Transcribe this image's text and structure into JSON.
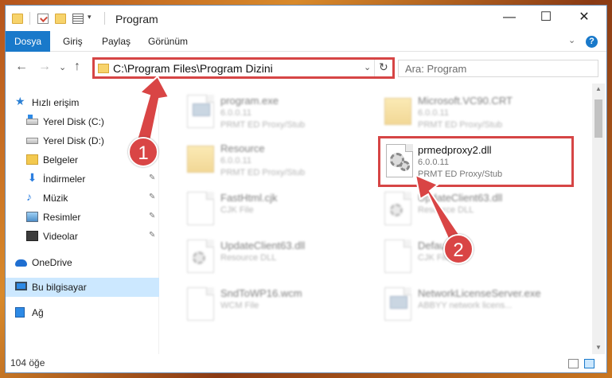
{
  "window": {
    "title": "Program",
    "controls": {
      "minimize": "—",
      "maximize": "☐",
      "close": "✕"
    }
  },
  "ribbon": {
    "tabs": [
      {
        "label": "Dosya"
      },
      {
        "label": "Giriş"
      },
      {
        "label": "Paylaş"
      },
      {
        "label": "Görünüm"
      }
    ],
    "collapse": "⌄",
    "help": "?"
  },
  "navigation": {
    "back": "←",
    "forward": "→",
    "history": "⌄",
    "up": "↑",
    "address": "C:\\Program Files\\Program Dizini",
    "address_dropdown": "⌄",
    "refresh": "↻",
    "search_placeholder": "Ara: Program"
  },
  "sidebar": {
    "items": [
      {
        "label": "Hızlı erişim",
        "icon": "star-icon"
      },
      {
        "label": "Yerel Disk (C:)",
        "icon": "drive-icon"
      },
      {
        "label": "Yerel Disk (D:)",
        "icon": "drive-icon"
      },
      {
        "label": "Belgeler",
        "icon": "folder-icon"
      },
      {
        "label": "İndirmeler",
        "icon": "download-icon"
      },
      {
        "label": "Müzik",
        "icon": "music-icon"
      },
      {
        "label": "Resimler",
        "icon": "pictures-icon"
      },
      {
        "label": "Videolar",
        "icon": "video-icon"
      },
      {
        "label": "OneDrive",
        "icon": "cloud-icon"
      },
      {
        "label": "Bu bilgisayar",
        "icon": "computer-icon"
      },
      {
        "label": "Ağ",
        "icon": "network-icon"
      }
    ],
    "pin": "📌"
  },
  "files": [
    {
      "name": "program.exe",
      "version": "6.0.0.11",
      "desc": "PRMT ED Proxy/Stub",
      "icon": "exe-icon"
    },
    {
      "name": "Microsoft.VC90.CRT",
      "version": "6.0.0.11",
      "desc": "PRMT ED Proxy/Stub",
      "icon": "folder-icon"
    },
    {
      "name": "Resource",
      "version": "6.0.0.11",
      "desc": "PRMT ED Proxy/Stub",
      "icon": "folder-icon"
    },
    {
      "name": "prmedproxy2.dll",
      "version": "6.0.0.11",
      "desc": "PRMT ED Proxy/Stub",
      "icon": "dll-icon"
    },
    {
      "name": "FastHtml.cjk",
      "version": "CJK File",
      "desc": "",
      "icon": "file-icon"
    },
    {
      "name": "UpdateClient63.dll",
      "version": "Resource DLL",
      "desc": "",
      "icon": "dll-icon"
    },
    {
      "name": "UpdateClient63.dll",
      "version": "Resource DLL",
      "desc": "",
      "icon": "dll-icon"
    },
    {
      "name": "Default.cjk",
      "version": "CJK File",
      "desc": "",
      "icon": "file-icon"
    },
    {
      "name": "SndToWP16.wcm",
      "version": "WCM File",
      "desc": "",
      "icon": "file-icon"
    },
    {
      "name": "NetworkLicenseServer.exe",
      "version": "ABBYY network licens...",
      "desc": "",
      "icon": "exe-icon"
    }
  ],
  "status": {
    "item_count": "104 öğe"
  },
  "markers": {
    "one": "1",
    "two": "2"
  },
  "colors": {
    "accent": "#1979ca",
    "highlight": "#d64545",
    "selected": "#cce8ff"
  }
}
